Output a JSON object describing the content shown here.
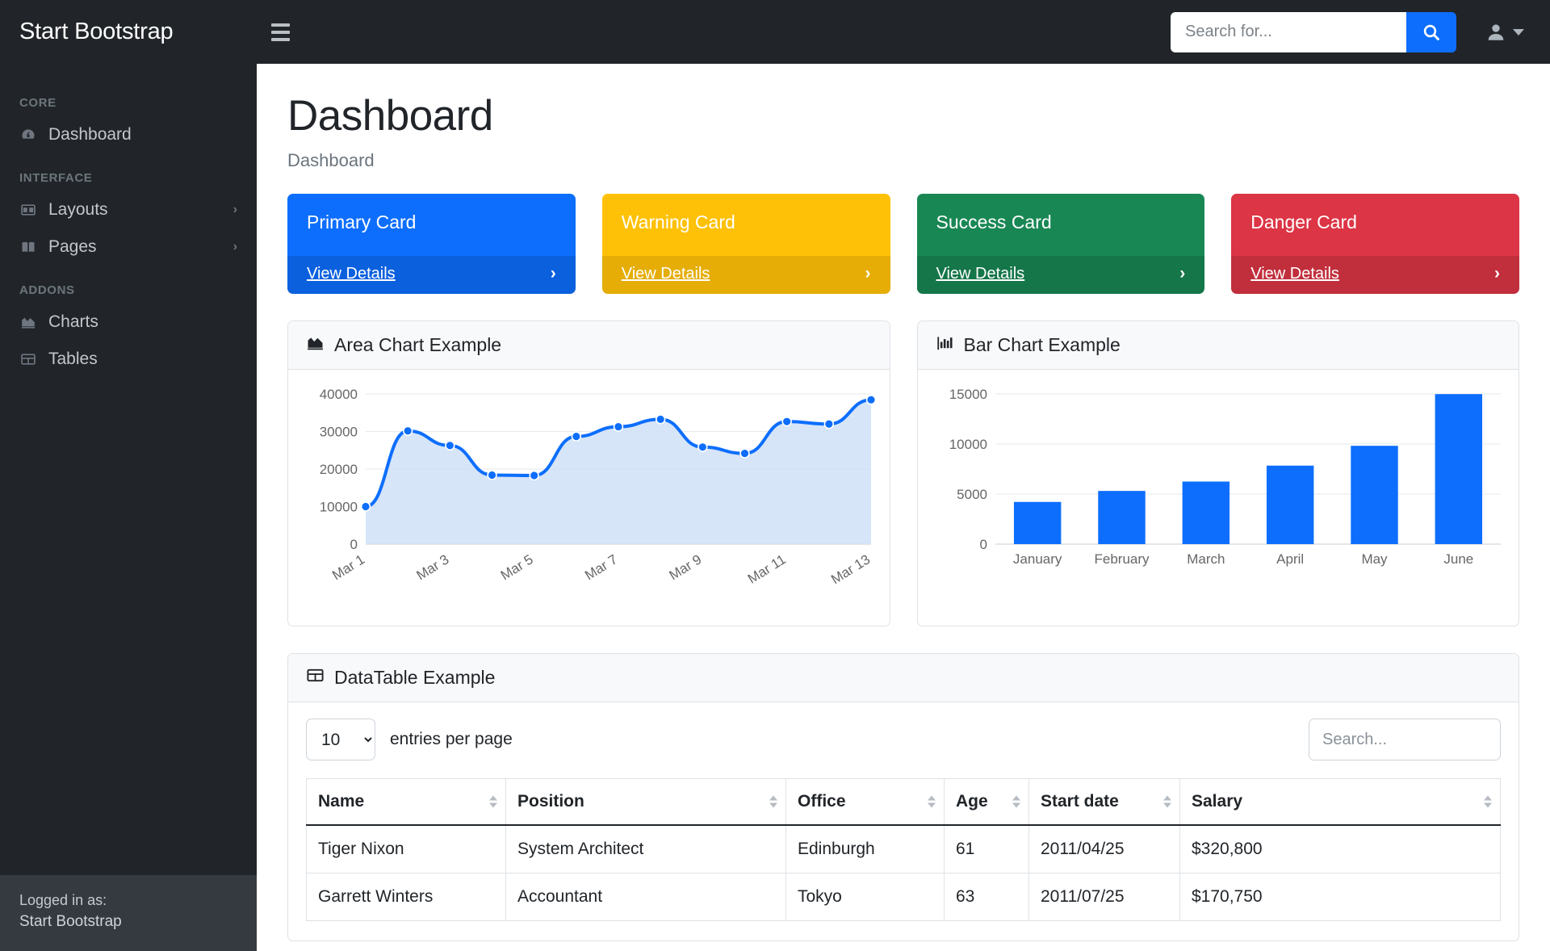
{
  "navbar": {
    "brand": "Start Bootstrap",
    "toggle_icon": "hamburger-icon",
    "search_placeholder": "Search for...",
    "search_value": "",
    "search_button_icon": "search-icon",
    "user_icon": "user-icon"
  },
  "sidebar": {
    "groups": [
      {
        "heading": "CORE",
        "items": [
          {
            "label": "Dashboard",
            "icon": "gauge-icon",
            "chevron": "",
            "active": true
          }
        ]
      },
      {
        "heading": "INTERFACE",
        "items": [
          {
            "label": "Layouts",
            "icon": "columns-icon",
            "chevron": "›",
            "active": false
          },
          {
            "label": "Pages",
            "icon": "book-icon",
            "chevron": "›",
            "active": false
          }
        ]
      },
      {
        "heading": "ADDONS",
        "items": [
          {
            "label": "Charts",
            "icon": "chart-area-icon",
            "chevron": "",
            "active": false
          },
          {
            "label": "Tables",
            "icon": "table-icon",
            "chevron": "",
            "active": false
          }
        ]
      }
    ],
    "footer_label": "Logged in as:",
    "footer_user": "Start Bootstrap"
  },
  "page": {
    "title": "Dashboard",
    "breadcrumb": "Dashboard"
  },
  "cards": [
    {
      "title": "Primary Card",
      "link": "View Details",
      "arrow": "›",
      "color": "#0d6efd",
      "variant": "c-primary"
    },
    {
      "title": "Warning Card",
      "link": "View Details",
      "arrow": "›",
      "color": "#ffc107",
      "variant": "c-warning"
    },
    {
      "title": "Success Card",
      "link": "View Details",
      "arrow": "›",
      "color": "#198754",
      "variant": "c-success"
    },
    {
      "title": "Danger Card",
      "link": "View Details",
      "arrow": "›",
      "color": "#dc3545",
      "variant": "c-danger"
    }
  ],
  "panels": {
    "area_title": "Area Chart Example",
    "area_icon": "chart-area-icon",
    "bar_title": "Bar Chart Example",
    "bar_icon": "chart-bar-icon",
    "table_title": "DataTable Example",
    "table_icon": "table-icon"
  },
  "chart_data": [
    {
      "type": "area",
      "title": "Area Chart Example",
      "x": [
        "Mar 1",
        "Mar 2",
        "Mar 3",
        "Mar 4",
        "Mar 5",
        "Mar 6",
        "Mar 7",
        "Mar 8",
        "Mar 9",
        "Mar 10",
        "Mar 11",
        "Mar 12",
        "Mar 13"
      ],
      "tick_labels": [
        "Mar 1",
        "Mar 3",
        "Mar 5",
        "Mar 7",
        "Mar 9",
        "Mar 11",
        "Mar 13"
      ],
      "values": [
        10000,
        30162,
        26263,
        18394,
        18287,
        28682,
        31274,
        33259,
        25849,
        24159,
        32651,
        31984,
        38451
      ],
      "ylim": [
        0,
        40000
      ],
      "yticks": [
        0,
        10000,
        20000,
        30000,
        40000
      ],
      "xlabel": "",
      "ylabel": "",
      "grid": true,
      "legend": "none",
      "line_color": "#0d6efd",
      "fill_color": "#cfe0f7"
    },
    {
      "type": "bar",
      "title": "Bar Chart Example",
      "categories": [
        "January",
        "February",
        "March",
        "April",
        "May",
        "June"
      ],
      "values": [
        4215,
        5312,
        6251,
        7841,
        9821,
        14984
      ],
      "ylim": [
        0,
        15000
      ],
      "yticks": [
        0,
        5000,
        10000,
        15000
      ],
      "xlabel": "",
      "ylabel": "",
      "grid": true,
      "legend": "none",
      "bar_color": "#0d6efd"
    }
  ],
  "datatable": {
    "entries_value": "10",
    "entries_options": [
      "10",
      "25",
      "50",
      "100"
    ],
    "entries_label": "entries per page",
    "search_placeholder": "Search...",
    "search_value": "",
    "columns": [
      "Name",
      "Position",
      "Office",
      "Age",
      "Start date",
      "Salary"
    ],
    "rows": [
      {
        "name": "Tiger Nixon",
        "position": "System Architect",
        "office": "Edinburgh",
        "age": "61",
        "start": "2011/04/25",
        "salary": "$320,800"
      },
      {
        "name": "Garrett Winters",
        "position": "Accountant",
        "office": "Tokyo",
        "age": "63",
        "start": "2011/07/25",
        "salary": "$170,750"
      }
    ]
  }
}
